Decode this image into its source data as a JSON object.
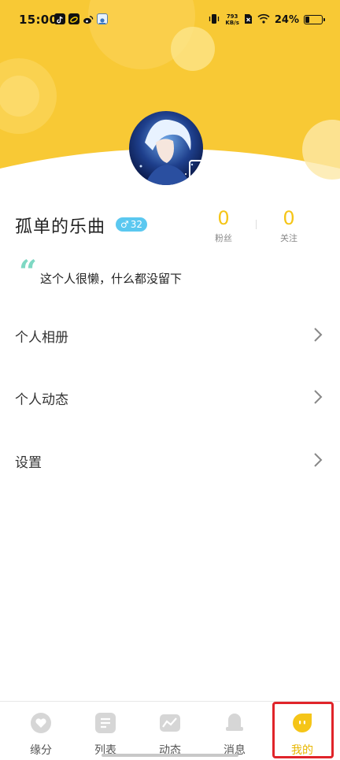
{
  "status_bar": {
    "time": "15:00",
    "net_speed_value": "793",
    "net_speed_unit": "KB/s",
    "battery_percent": "24%",
    "battery_level": 0.24,
    "icons": [
      "tiktok-icon",
      "app-icon",
      "weibo-icon",
      "cloud-app-icon",
      "vibrate-icon",
      "sim-icon",
      "wifi-icon",
      "battery-icon"
    ]
  },
  "theme": {
    "header_color": "#f8c935",
    "accent_color": "#f5c518",
    "badge_color": "#5bc8f0",
    "quote_color": "#7ed8c3",
    "highlight_border": "#e0242a"
  },
  "profile": {
    "name": "孤单的乐曲",
    "gender_symbol": "♂",
    "age": "32",
    "fans_count": "0",
    "fans_label": "粉丝",
    "following_count": "0",
    "following_label": "关注",
    "quote_mark": "“",
    "bio": "这个人很懒，什么都没留下"
  },
  "menu": [
    {
      "label": "个人相册"
    },
    {
      "label": "个人动态"
    },
    {
      "label": "设置"
    }
  ],
  "tabs": [
    {
      "label": "缘分",
      "icon": "heart-icon"
    },
    {
      "label": "列表",
      "icon": "list-icon"
    },
    {
      "label": "动态",
      "icon": "chart-icon"
    },
    {
      "label": "消息",
      "icon": "bell-icon"
    },
    {
      "label": "我的",
      "icon": "profile-face-icon",
      "active": true
    }
  ]
}
